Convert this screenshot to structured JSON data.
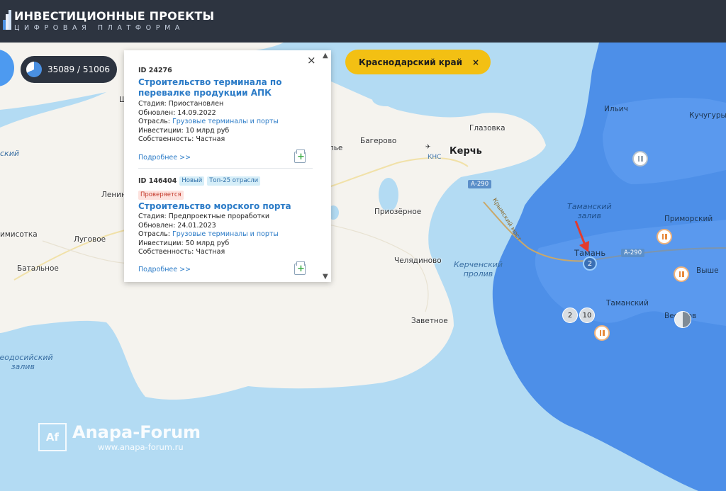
{
  "header": {
    "logo_title": "ИНВЕСТИЦИОННЫЕ ПРОЕКТЫ",
    "logo_subtitle": "ЦИФРОВАЯ ПЛАТФОРМА"
  },
  "toolbar": {
    "counter": "35089 / 51006",
    "region_filter": "Краснодарский край",
    "region_close": "×"
  },
  "popup": {
    "close": "×",
    "cards": [
      {
        "id": "ID 24276",
        "title": "Строительство терминала по перевалке продукции АПК",
        "stage": "Стадия: Приостановлен",
        "updated": "Обновлен: 14.09.2022",
        "industry_label": "Отрасль: ",
        "industry": "Грузовые терминалы и порты",
        "investment": "Инвестиции: 10 млрд руб",
        "ownership": "Собственность: Частная",
        "more": "Подробнее >>"
      },
      {
        "id": "ID 146404",
        "tag_new": "Новый",
        "tag_top": "Топ-25 отрасли",
        "tag_status": "Проверяется",
        "title": "Строительство морского порта",
        "stage": "Стадия: Предпроектные проработки",
        "updated": "Обновлен: 24.01.2023",
        "industry_label": "Отрасль: ",
        "industry": "Грузовые терминалы и порты",
        "investment": "Инвестиции: 50 млрд руб",
        "ownership": "Собственность: Частная",
        "more": "Подробнее >>"
      }
    ]
  },
  "map": {
    "labels": {
      "kerch": "Керчь",
      "kns": "КНС",
      "bagerovo": "Багерово",
      "glazovka": "Глазовка",
      "prizernoe": "Приозёрное",
      "chelyadinovo": "Челядиново",
      "zavetnoe": "Заветное",
      "lenino": "Ленино",
      "lugovoe": "Луговое",
      "batalnoe": "Батальное",
      "kamysheva": "имисотка",
      "ilyich": "Ильич",
      "kuchuguri": "Кучугуры",
      "primorsky": "Приморский",
      "taman": "Тамань",
      "tamansky": "Таманский",
      "vyshesteb": "Выше",
      "veselovka": "Весёлов",
      "lye": "лье",
      "ch": "Щ"
    },
    "sea_labels": {
      "kerch_strait": "Керченский\nпролив",
      "taman_bay": "Таманский\nзалив",
      "feodosia_bay": "Феодосийский\nзалив",
      "left_edge": "ский"
    },
    "road_a290": "А-290",
    "road_crimean_bridge": "Крымский мост",
    "markers": {
      "cluster_selected": "2",
      "cluster_a": "2",
      "cluster_b": "10"
    }
  },
  "watermark": {
    "logo": "Af",
    "title": "Anapa-Forum",
    "url": "www.anapa-forum.ru"
  },
  "colors": {
    "header_bg": "#2d3440",
    "accent_yellow": "#f3c013",
    "region_highlight": "#4d8fe8",
    "link_blue": "#2b7bc7"
  }
}
